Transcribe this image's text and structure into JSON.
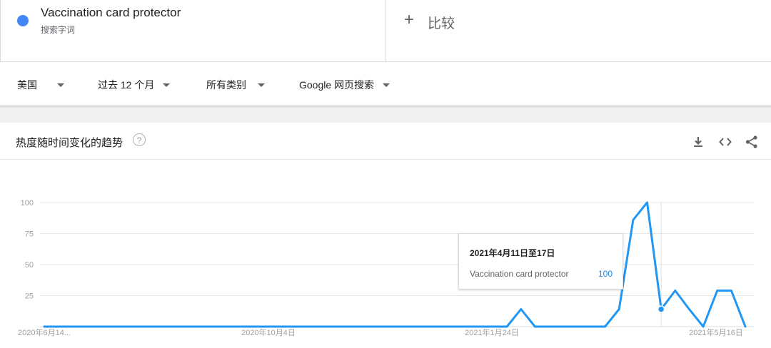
{
  "term": {
    "name": "Vaccination card protector",
    "type": "搜索字词",
    "color": "#4285f4"
  },
  "compare": {
    "plus": "+",
    "label": "比较"
  },
  "filters": {
    "region": "美国",
    "time": "过去 12 个月",
    "category": "所有类别",
    "property": "Google 网页搜索"
  },
  "card": {
    "title": "热度随时间变化的趋势",
    "help": "?"
  },
  "tooltip": {
    "date": "2021年4月11日至17日",
    "term": "Vaccination card protector",
    "value": "100"
  },
  "icons": [
    "download-icon",
    "embed-icon",
    "share-icon",
    "help-icon"
  ],
  "colors": {
    "line": "#2196f3",
    "accent": "#1e88e5"
  },
  "chart_data": {
    "type": "line",
    "title": "热度随时间变化的趋势",
    "xlabel": "",
    "ylabel": "",
    "ylim": [
      0,
      100
    ],
    "yticks": [
      "100",
      "75",
      "50",
      "25"
    ],
    "xtick_labels": [
      "2020年6月14...",
      "2020年10月4日",
      "2021年1月24日",
      "2021年5月16日"
    ],
    "grid": true,
    "highlight_index": 44,
    "series": [
      {
        "name": "Vaccination card protector",
        "values": [
          0,
          0,
          0,
          0,
          0,
          0,
          0,
          0,
          0,
          0,
          0,
          0,
          0,
          0,
          0,
          0,
          0,
          0,
          0,
          0,
          0,
          0,
          0,
          0,
          0,
          0,
          0,
          0,
          0,
          0,
          0,
          0,
          0,
          0,
          14,
          0,
          0,
          0,
          0,
          0,
          0,
          14,
          86,
          100,
          14,
          29,
          14,
          0,
          29,
          29,
          0
        ]
      }
    ]
  }
}
